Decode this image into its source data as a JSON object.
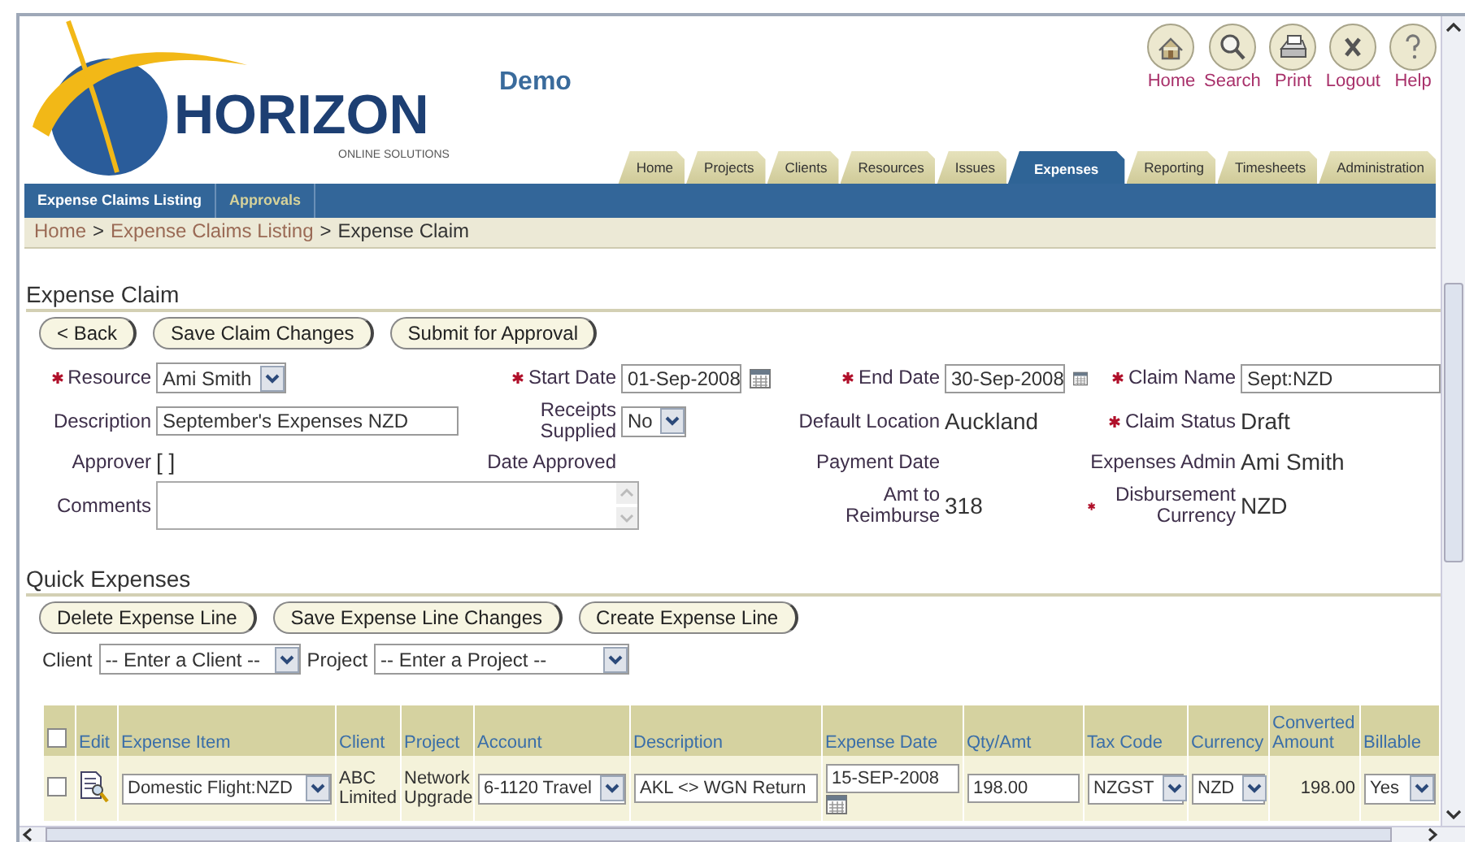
{
  "header": {
    "logo": {
      "name": "HORIZON",
      "tagline": "ONLINE SOLUTIONS"
    },
    "title": "Demo",
    "shortcuts": [
      {
        "label": "Home",
        "kind": "home"
      },
      {
        "label": "Search",
        "kind": "search"
      },
      {
        "label": "Print",
        "kind": "print"
      },
      {
        "label": "Logout",
        "kind": "logout"
      },
      {
        "label": "Help",
        "kind": "help"
      }
    ]
  },
  "tabs": [
    {
      "label": "Home",
      "selected": false
    },
    {
      "label": "Projects",
      "selected": false
    },
    {
      "label": "Clients",
      "selected": false
    },
    {
      "label": "Resources",
      "selected": false
    },
    {
      "label": "Issues",
      "selected": false
    },
    {
      "label": "Expenses",
      "selected": true
    },
    {
      "label": "Reporting",
      "selected": false
    },
    {
      "label": "Timesheets",
      "selected": false
    },
    {
      "label": "Administration",
      "selected": false
    }
  ],
  "subtabs": [
    {
      "label": "Expense Claims Listing",
      "selected": true
    },
    {
      "label": "Approvals",
      "selected": false
    }
  ],
  "breadcrumb": [
    {
      "label": "Home",
      "kind": "link"
    },
    {
      "label": ">",
      "kind": "separator"
    },
    {
      "label": "Expense Claims Listing",
      "kind": "link"
    },
    {
      "label": ">",
      "kind": "separator"
    },
    {
      "label": "Expense Claim",
      "kind": "current"
    }
  ],
  "claim": {
    "title": "Expense Claim",
    "buttons": [
      "< Back",
      "Save Claim Changes",
      "Submit for Approval"
    ],
    "rows": [
      [
        {
          "label": "Resource",
          "required": true,
          "kind": "select",
          "value": "Ami Smith"
        },
        {
          "label": "Start Date",
          "required": true,
          "kind": "date",
          "value": "01-Sep-2008"
        },
        {
          "label": "End Date",
          "required": true,
          "kind": "date",
          "value": "30-Sep-2008"
        },
        {
          "label": "Claim Name",
          "required": true,
          "kind": "text",
          "value": "Sept:NZD"
        }
      ],
      [
        {
          "label": "Description",
          "required": false,
          "kind": "text",
          "value": "September's Expenses NZD"
        },
        {
          "label": "Receipts Supplied",
          "required": false,
          "kind": "select",
          "value": "No"
        },
        {
          "label": "Default Location",
          "required": false,
          "kind": "value",
          "value": "Auckland"
        },
        {
          "label": "Claim Status",
          "required": true,
          "kind": "value",
          "value": "Draft"
        }
      ],
      [
        {
          "label": "Approver",
          "required": false,
          "kind": "value",
          "value": "[ ]"
        },
        {
          "label": "Date Approved",
          "required": false,
          "kind": "label"
        },
        {
          "label": "Payment Date",
          "required": false,
          "kind": "label"
        },
        {
          "label": "Expenses Admin",
          "required": false,
          "kind": "value",
          "value": "Ami Smith"
        }
      ],
      [
        {
          "label": "Comments",
          "required": false,
          "kind": "textarea"
        },
        "",
        {
          "label": "Amt to Reimburse",
          "required": false,
          "kind": "value",
          "value": "318"
        },
        {
          "label": "Disbursement Currency",
          "required": true,
          "kind": "value",
          "value": "NZD"
        }
      ]
    ]
  },
  "quick_expenses": {
    "title": "Quick Expenses",
    "buttons": [
      "Delete Expense Line",
      "Save Expense Line Changes",
      "Create Expense Line"
    ],
    "filters": [
      {
        "label": "Client",
        "value": "-- Enter a Client --"
      },
      {
        "label": "Project",
        "value": "-- Enter a Project --"
      }
    ],
    "table": {
      "columns": [
        {
          "kind": "checkbox",
          "checked": false
        },
        {
          "kind": "text",
          "label": "Edit"
        },
        {
          "kind": "text",
          "label": "Expense Item"
        },
        {
          "kind": "text",
          "label": "Client"
        },
        {
          "kind": "text",
          "label": "Project"
        },
        {
          "kind": "text",
          "label": "Account"
        },
        {
          "kind": "text",
          "label": "Description"
        },
        {
          "kind": "text",
          "label": "Expense Date"
        },
        {
          "kind": "text",
          "label": "Qty/Amt"
        },
        {
          "kind": "text",
          "label": "Tax Code"
        },
        {
          "kind": "text",
          "label": "Currency"
        },
        {
          "kind": "text",
          "label": "Converted Amount"
        },
        {
          "kind": "text",
          "label": "Billable"
        }
      ],
      "rows": [
        {
          "cells": [
            {
              "kind": "checkbox",
              "checked": false
            },
            {
              "kind": "edit"
            },
            {
              "kind": "select",
              "value": "Domestic Flight:NZD"
            },
            {
              "kind": "text",
              "value": "ABC Limited"
            },
            {
              "kind": "text",
              "value": "Network Upgrade"
            },
            {
              "kind": "select",
              "value": "6-1120 Travel"
            },
            {
              "kind": "input",
              "value": "AKL <> WGN Return"
            },
            {
              "kind": "date",
              "value": "15-SEP-2008"
            },
            {
              "kind": "input",
              "value": "198.00"
            },
            {
              "kind": "select",
              "value": "NZGST"
            },
            {
              "kind": "select",
              "value": "NZD"
            },
            {
              "kind": "number",
              "value": "198.00"
            },
            {
              "kind": "select",
              "value": "Yes"
            }
          ]
        }
      ]
    }
  }
}
